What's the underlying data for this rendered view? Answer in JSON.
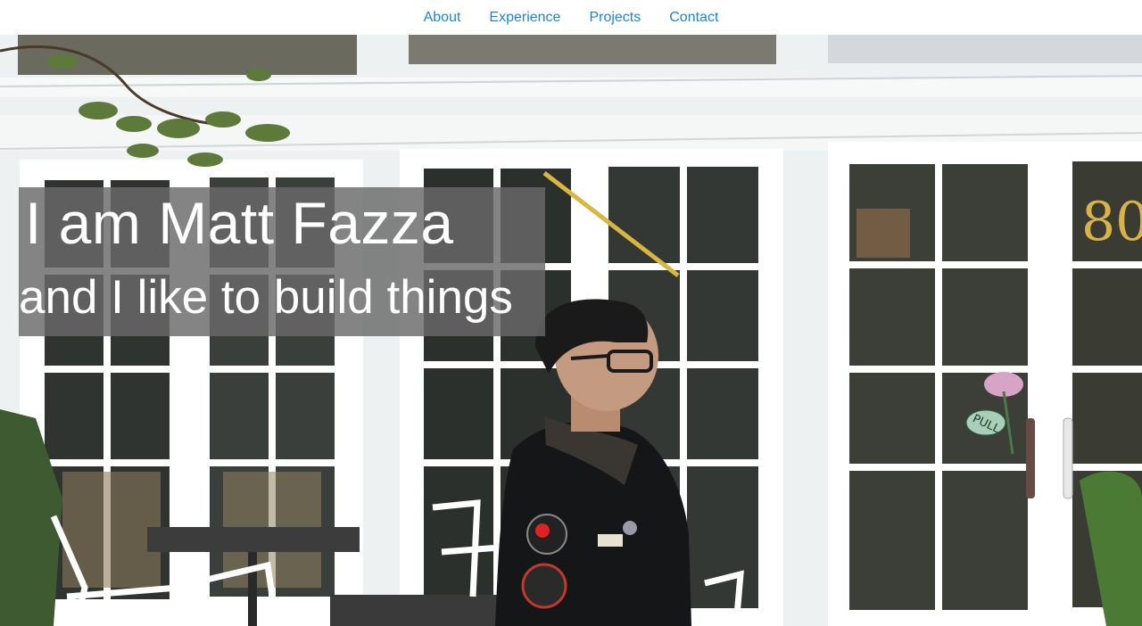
{
  "nav": {
    "items": [
      {
        "label": "About"
      },
      {
        "label": "Experience"
      },
      {
        "label": "Projects"
      },
      {
        "label": "Contact"
      }
    ]
  },
  "hero": {
    "title": "I am Matt Fazza",
    "subtitle": "and I like to build things",
    "door_sign": "PULL",
    "door_number": "80"
  },
  "colors": {
    "nav_link": "#1a86d8",
    "overlay": "#696969",
    "text": "#ffffff"
  }
}
